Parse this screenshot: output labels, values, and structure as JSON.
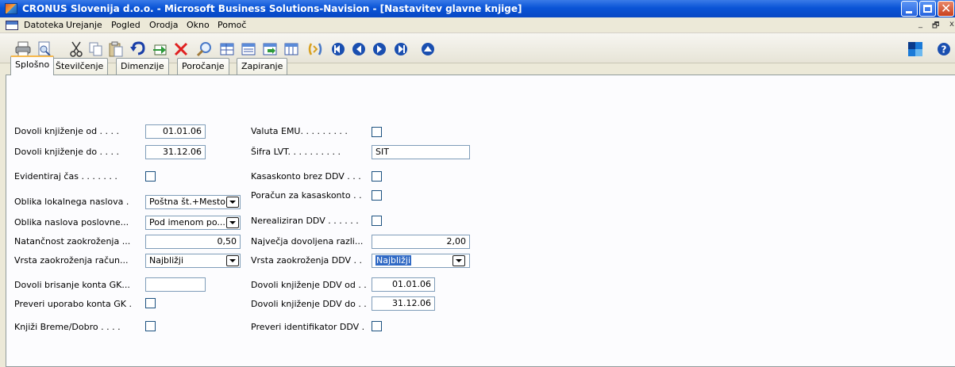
{
  "window": {
    "title": "CRONUS Slovenija d.o.o. - Microsoft Business Solutions-Navision - [Nastavitev glavne knjige]"
  },
  "menu": {
    "items": [
      "Datoteka",
      "Urejanje",
      "Pogled",
      "Orodja",
      "Okno",
      "Pomoč"
    ],
    "mdi_controls": [
      "_",
      "🗗",
      "x"
    ]
  },
  "toolbar": {
    "buttons": [
      "print-icon",
      "print-preview-icon",
      "cut-icon",
      "copy-icon",
      "paste-icon",
      "undo-icon",
      "insert-record-icon",
      "delete-icon",
      "find-icon",
      "table-icon",
      "list-icon",
      "card-icon",
      "matrix-icon",
      "navigate-icon",
      "first-record-icon",
      "previous-record-icon",
      "next-record-icon",
      "last-record-icon",
      "up-icon",
      "windows-icon",
      "help-icon"
    ]
  },
  "tabs": [
    "Splošno",
    "Številčenje",
    "Dimenzije",
    "Poročanje",
    "Zapiranje"
  ],
  "form": {
    "left": [
      {
        "label": "Dovoli knjiženje od . . . .",
        "value": "01.01.06",
        "kind": "date"
      },
      {
        "label": "Dovoli knjiženje do . . . .",
        "value": "31.12.06",
        "kind": "date"
      },
      {
        "label": "Evidentiraj čas . . . . . . .",
        "value": "",
        "kind": "checkbox"
      },
      {
        "label": "Oblika lokalnega naslova  .",
        "value": "Poštna št.+Mesto",
        "kind": "dropdown"
      },
      {
        "label": "Oblika naslova poslovne...",
        "value": "Pod imenom po...",
        "kind": "dropdown"
      },
      {
        "label": "Natančnost zaokroženja ...",
        "value": "0,50",
        "kind": "decimal"
      },
      {
        "label": "Vrsta zaokroženja račun...",
        "value": "Najbližji",
        "kind": "dropdown"
      },
      {
        "label": "Dovoli brisanje konta GK...",
        "value": "",
        "kind": "text"
      },
      {
        "label": "Preveri uporabo konta GK .",
        "value": "",
        "kind": "checkbox"
      },
      {
        "label": "Knjiži Breme/Dobro . . . .",
        "value": "",
        "kind": "checkbox"
      }
    ],
    "right": [
      {
        "label": "Valuta EMU. . . . . . . . .",
        "value": "",
        "kind": "checkbox"
      },
      {
        "label": "Šifra LVT. . . . . . . . . .",
        "value": "SIT",
        "kind": "text"
      },
      {
        "label": "Kasaskonto brez DDV . . .",
        "value": "",
        "kind": "checkbox"
      },
      {
        "label": "Poračun za kasaskonto  . .",
        "value": "",
        "kind": "checkbox"
      },
      {
        "label": "Nerealiziran DDV . . . . . .",
        "value": "",
        "kind": "checkbox"
      },
      {
        "label": "Največja dovoljena razli...",
        "value": "2,00",
        "kind": "decimal"
      },
      {
        "label": "Vrsta zaokroženja DDV . .",
        "value": "Najbližji",
        "kind": "dropdown"
      },
      {
        "label": "Dovoli knjiženje DDV od . .",
        "value": "01.01.06",
        "kind": "date"
      },
      {
        "label": "Dovoli knjiženje DDV do . .",
        "value": "31.12.06",
        "kind": "date"
      },
      {
        "label": "Preveri identifikator DDV  .",
        "value": "",
        "kind": "checkbox"
      }
    ]
  },
  "colors": {
    "titlebar": "#0a54d6",
    "active_tab_accent": "#f6b84c",
    "selection": "#316ac5"
  }
}
